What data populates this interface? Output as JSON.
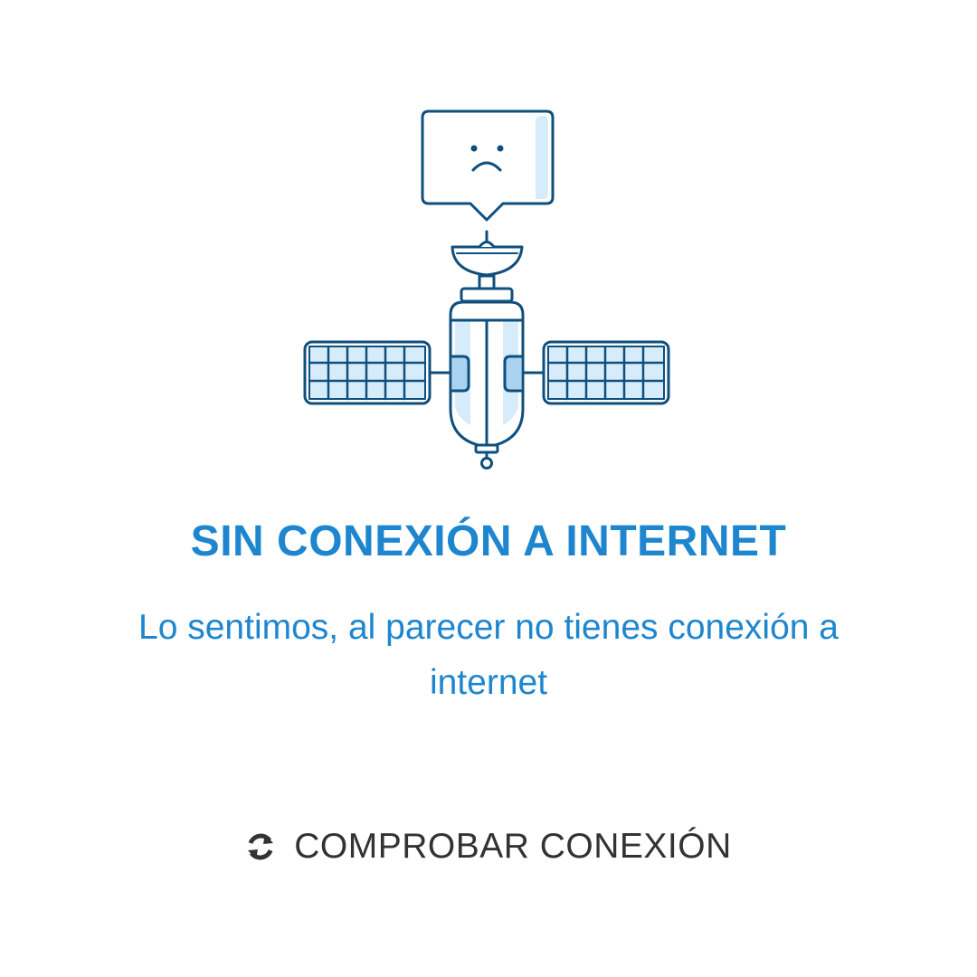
{
  "screen": {
    "title": "SIN CONEXIÓN A INTERNET",
    "message": "Lo sentimos, al parecer no tienes conexión a internet",
    "illustration_icon": "satellite-sad-icon",
    "speech_icon": "sad-face-icon"
  },
  "actions": {
    "retry_label": "COMPROBAR CONEXIÓN",
    "retry_icon": "refresh-icon"
  },
  "colors": {
    "accent": "#1e86cf",
    "outline": "#0f4f7d",
    "fill_light": "#d7ecfa",
    "action_text": "#333333",
    "background": "#ffffff"
  }
}
